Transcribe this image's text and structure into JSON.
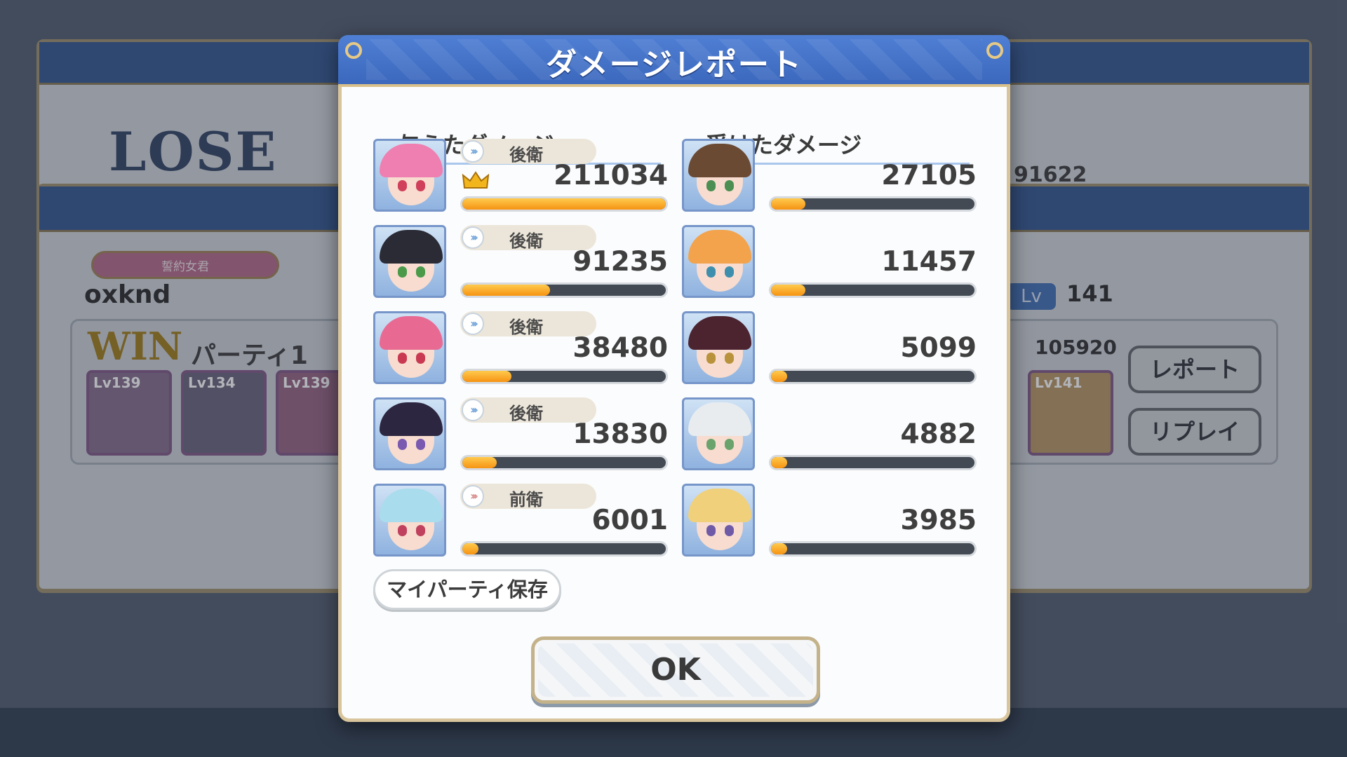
{
  "background": {
    "lose_label": "LOSE",
    "top_score": "91622",
    "title_badge": "誓約女君",
    "player_name": "oxknd",
    "win_label": "WIN",
    "party_label": "パーティ1",
    "thumbs": [
      "Lv139",
      "Lv134",
      "Lv139",
      "Lv141"
    ],
    "lv_chip": "Lv",
    "lv_value": "141",
    "right_score": "105920",
    "report_button": "レポート",
    "replay_button": "リプレイ"
  },
  "dialog": {
    "title": "ダメージレポート",
    "dealt_heading": "与えたダメージ",
    "taken_heading": "受けたダメージ",
    "dealt": [
      {
        "position": "後衛",
        "value": "211034",
        "fill": 1.0,
        "top": true,
        "hair": "#ef7fb0",
        "eyes": "#d0405a",
        "front": false
      },
      {
        "position": "後衛",
        "value": "91235",
        "fill": 0.43,
        "top": false,
        "hair": "#2b2b36",
        "eyes": "#4a9a4a",
        "front": false
      },
      {
        "position": "後衛",
        "value": "38480",
        "fill": 0.24,
        "top": false,
        "hair": "#e86a93",
        "eyes": "#c93a52",
        "front": false
      },
      {
        "position": "後衛",
        "value": "13830",
        "fill": 0.17,
        "top": false,
        "hair": "#2c2640",
        "eyes": "#7a5ab0",
        "front": false
      },
      {
        "position": "前衛",
        "value": "6001",
        "fill": 0.08,
        "top": false,
        "hair": "#a9dcec",
        "eyes": "#c0415e",
        "front": true
      }
    ],
    "taken": [
      {
        "value": "27105",
        "fill": 0.17,
        "hair": "#6b4a33",
        "eyes": "#4b8f52"
      },
      {
        "value": "11457",
        "fill": 0.17,
        "hair": "#f2a34c",
        "eyes": "#3e8fae"
      },
      {
        "value": "5099",
        "fill": 0.08,
        "hair": "#4b2430",
        "eyes": "#b9923c"
      },
      {
        "value": "4882",
        "fill": 0.08,
        "hair": "#e8ecef",
        "eyes": "#6aa36b"
      },
      {
        "value": "3985",
        "fill": 0.08,
        "hair": "#f0d07a",
        "eyes": "#6f5aa8"
      }
    ],
    "save_party_button": "マイパーティ保存",
    "ok_button": "OK"
  },
  "colors": {
    "header_blue": "#3b68bd",
    "bar_orange": "#f69313",
    "accent_gold": "#d9c59c"
  }
}
